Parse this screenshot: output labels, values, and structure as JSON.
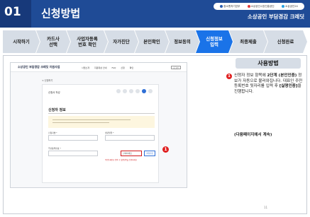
{
  "header": {
    "number": "01",
    "title": "신청방법",
    "logos": [
      "중소벤처기업부",
      "소상공인시장진흥공단",
      "소상공인24"
    ],
    "brand": "소상공인 부담경감 크레딧"
  },
  "steps": [
    {
      "label": "시작하기",
      "active": false
    },
    {
      "label": "카드사\n선택",
      "active": false
    },
    {
      "label": "사업자등록\n번호 확인",
      "active": false
    },
    {
      "label": "자가진단",
      "active": false
    },
    {
      "label": "본인확인",
      "active": false
    },
    {
      "label": "정보동의",
      "active": false
    },
    {
      "label": "신청정보\n입력",
      "active": true
    },
    {
      "label": "최종제출",
      "active": false
    },
    {
      "label": "신청완료",
      "active": false
    }
  ],
  "screenshot": {
    "site_title": "소상공인 부담경감 크레딧 지원사업",
    "nav": [
      "사업소개",
      "지원대상 안내",
      "FAQ",
      "신청",
      "확인"
    ],
    "login": "로그인",
    "breadcrumb": "< 신청하기",
    "card_title": "신청서 작성",
    "section_title": "신청자 정보",
    "fields": {
      "name_label": "신청자명 *",
      "birth_label": "생년월일 *",
      "rrn_label": "주민등록번호 *",
      "rrn_select": "선택하세요",
      "verify_button": "실명인증"
    },
    "warning": "주민등록번호 입력 후 실명인증을 진행하세요"
  },
  "callout_number": "1",
  "description": {
    "heading": "사용방법",
    "text_before": "신청자 정보 항목에 ",
    "text_bold1": "2단계 (본인인증)",
    "text_mid": " 정보가 자동으로 불러와집니다. 대표인 주민등록번호 뒷자리를 입력 후 ",
    "text_bold2": "[실명인증]",
    "text_after": "을 진행합니다.",
    "continued": "(다음페이지에서 계속)"
  },
  "page_number": "11"
}
